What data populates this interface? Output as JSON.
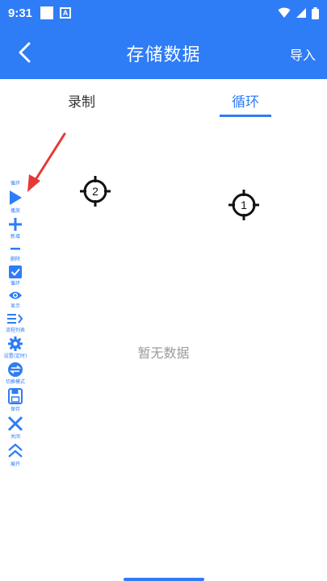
{
  "status_bar": {
    "time": "9:31",
    "a_badge": "A"
  },
  "app_bar": {
    "title": "存储数据",
    "action": "导入"
  },
  "tabs": [
    {
      "label": "录制",
      "active": false
    },
    {
      "label": "循环",
      "active": true
    }
  ],
  "empty_state": "暂无数据",
  "toolbar": {
    "header": "循环",
    "items": [
      {
        "label": "播放",
        "icon": "play-icon"
      },
      {
        "label": "新增",
        "icon": "plus-icon"
      },
      {
        "label": "删除",
        "icon": "minus-icon"
      },
      {
        "label": "循环",
        "icon": "checkbox-icon"
      },
      {
        "label": "显示",
        "icon": "eye-icon"
      },
      {
        "label": "流程列表",
        "icon": "list-icon"
      },
      {
        "label": "设置(定时)",
        "icon": "gear-icon"
      },
      {
        "label": "切换模式",
        "icon": "switch-icon"
      },
      {
        "label": "保存",
        "icon": "save-icon"
      },
      {
        "label": "关闭",
        "icon": "close-icon"
      },
      {
        "label": "展开",
        "icon": "expand-icon"
      }
    ]
  },
  "targets": [
    {
      "number": "2"
    },
    {
      "number": "1"
    }
  ],
  "colors": {
    "primary": "#2e7cf6",
    "arrow": "#e53935",
    "muted_text": "#9a9a9a"
  }
}
